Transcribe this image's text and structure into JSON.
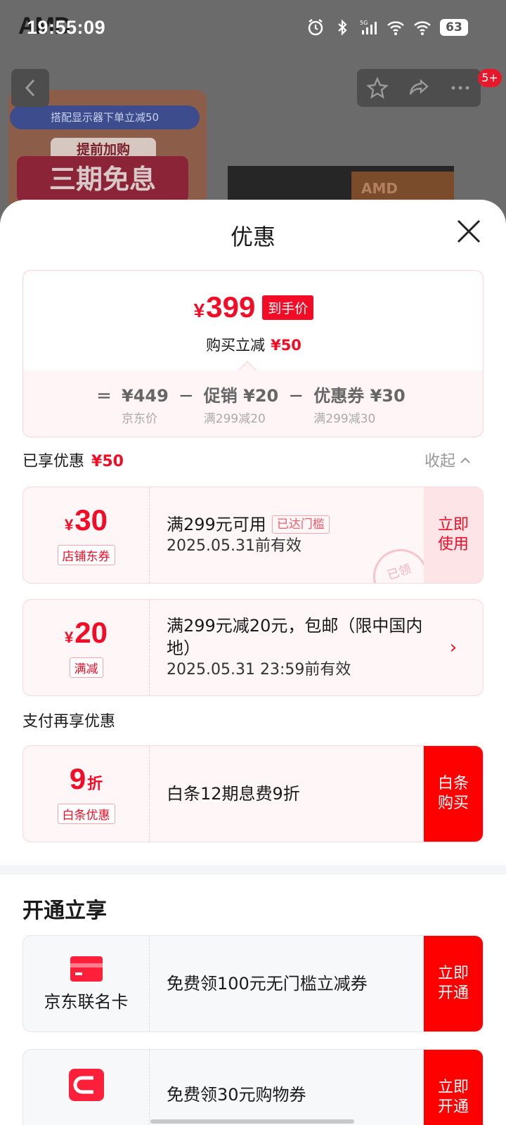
{
  "status_bar": {
    "time": "19:55:09",
    "battery": "63",
    "network": "5G"
  },
  "background_page": {
    "brand_logo": "AMD",
    "promo_bar": "搭配显示器下单立减50",
    "promo_tag": "提前加购",
    "promo_big": "三期免息",
    "box_brand": "AMD",
    "nav_badge": "5+"
  },
  "sheet": {
    "title": "优惠",
    "summary": {
      "currency": "¥",
      "final_price": "399",
      "final_tag": "到手价",
      "cut_label": "购买立减",
      "cut_amount": "¥50",
      "calc": {
        "eq": "=",
        "minus": "−",
        "base_value": "¥449",
        "base_label": "京东价",
        "promo_value": "促销 ¥20",
        "promo_label": "满299减20",
        "coupon_value": "优惠券 ¥30",
        "coupon_label": "满299减30"
      }
    },
    "enjoyed": {
      "label": "已享优惠",
      "amount": "¥50",
      "collapse": "收起"
    },
    "coupons": [
      {
        "amount": "30",
        "kind": "店铺东券",
        "main": "满299元可用",
        "badge": "已达门槛",
        "validity": "2025.05.31前有效",
        "action": "立即使用",
        "stamp": "已领"
      },
      {
        "amount": "20",
        "kind": "满减",
        "main": "满299元减20元，包邮（限中国内地）",
        "validity": "2025.05.31 23:59前有效",
        "action": "›"
      }
    ],
    "pay_section": {
      "label": "支付再享优惠",
      "amount": "9",
      "suffix": "折",
      "kind": "白条优惠",
      "main": "白条12期息费9折",
      "action": "白条购买"
    },
    "open_section": {
      "title": "开通立享",
      "items": [
        {
          "name": "京东联名卡",
          "main": "免费领100元无门槛立减券",
          "action": "立即开通",
          "icon": "card-icon"
        },
        {
          "name": "",
          "main": "免费领30元购物券",
          "action": "立即开通",
          "icon": "wallet-icon"
        }
      ]
    }
  },
  "colors": {
    "accent": "#f20c26",
    "button_red": "#fe0000"
  }
}
